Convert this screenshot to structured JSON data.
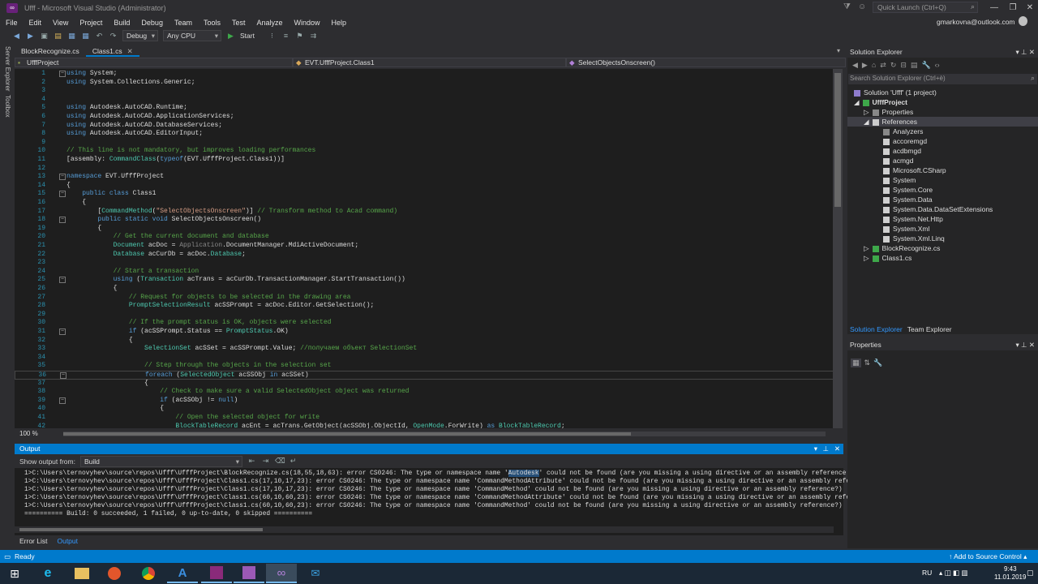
{
  "window": {
    "title": "Ufff - Microsoft Visual Studio (Administrator)",
    "quick_launch_placeholder": "Quick Launch (Ctrl+Q)",
    "user": "gmarkovna@outlook.com"
  },
  "menu": [
    "File",
    "Edit",
    "View",
    "Project",
    "Build",
    "Debug",
    "Team",
    "Tools",
    "Test",
    "Analyze",
    "Window",
    "Help"
  ],
  "toolbar": {
    "config": "Debug",
    "platform": "Any CPU",
    "start": "Start"
  },
  "side_tabs": [
    "Server Explorer",
    "Toolbox"
  ],
  "doc_tabs": [
    "BlockRecognize.cs",
    "Class1.cs"
  ],
  "nav": {
    "project": "UfffProject",
    "class": "EVT.UfffProject.Class1",
    "member": "SelectObjectsOnscreen()"
  },
  "code_lines": [
    {
      "n": "1",
      "t": "using System;",
      "k": "mix"
    },
    {
      "n": "2",
      "t": "using System.Collections.Generic;",
      "k": "mix"
    },
    {
      "n": "3",
      "t": "",
      "k": "tx"
    },
    {
      "n": "4",
      "t": "",
      "k": "tx"
    },
    {
      "n": "5",
      "t": "using Autodesk.AutoCAD.Runtime;",
      "k": "mix"
    },
    {
      "n": "6",
      "t": "using Autodesk.AutoCAD.ApplicationServices;",
      "k": "mix"
    },
    {
      "n": "7",
      "t": "using Autodesk.AutoCAD.DatabaseServices;",
      "k": "mix"
    },
    {
      "n": "8",
      "t": "using Autodesk.AutoCAD.EditorInput;",
      "k": "mix"
    },
    {
      "n": "9",
      "t": "",
      "k": "tx"
    },
    {
      "n": "10",
      "t": "// This line is not mandatory, but improves loading performances",
      "k": "cm"
    },
    {
      "n": "11",
      "t": "[assembly: CommandClass(typeof(EVT.UfffProject.Class1))]",
      "k": "tx"
    },
    {
      "n": "12",
      "t": "",
      "k": "tx"
    },
    {
      "n": "13",
      "t": "namespace EVT.UfffProject",
      "k": "mix"
    },
    {
      "n": "14",
      "t": "{",
      "k": "tx"
    },
    {
      "n": "15",
      "t": "    public class Class1",
      "k": "mix"
    },
    {
      "n": "16",
      "t": "    {",
      "k": "tx"
    },
    {
      "n": "17",
      "t": "        [CommandMethod(\"SelectObjectsOnscreen\")] // Transform method to Acad command)",
      "k": "tx"
    },
    {
      "n": "18",
      "t": "        public static void SelectObjectsOnscreen()",
      "k": "mix"
    },
    {
      "n": "19",
      "t": "        {",
      "k": "tx"
    },
    {
      "n": "20",
      "t": "            // Get the current document and database",
      "k": "cm"
    },
    {
      "n": "21",
      "t": "            Document acDoc = Application.DocumentManager.MdiActiveDocument;",
      "k": "tx"
    },
    {
      "n": "22",
      "t": "            Database acCurDb = acDoc.Database;",
      "k": "tx"
    },
    {
      "n": "23",
      "t": "",
      "k": "tx"
    },
    {
      "n": "24",
      "t": "            // Start a transaction",
      "k": "cm"
    },
    {
      "n": "25",
      "t": "            using (Transaction acTrans = acCurDb.TransactionManager.StartTransaction())",
      "k": "mix"
    },
    {
      "n": "26",
      "t": "            {",
      "k": "tx"
    },
    {
      "n": "27",
      "t": "                // Request for objects to be selected in the drawing area",
      "k": "cm"
    },
    {
      "n": "28",
      "t": "                PromptSelectionResult acSSPrompt = acDoc.Editor.GetSelection();",
      "k": "tx"
    },
    {
      "n": "29",
      "t": "",
      "k": "tx"
    },
    {
      "n": "30",
      "t": "                // If the prompt status is OK, objects were selected",
      "k": "cm"
    },
    {
      "n": "31",
      "t": "                if (acSSPrompt.Status == PromptStatus.OK)",
      "k": "mix"
    },
    {
      "n": "32",
      "t": "                {",
      "k": "tx"
    },
    {
      "n": "33",
      "t": "                    SelectionSet acSSet = acSSPrompt.Value; //получаем объект SelectionSet",
      "k": "tx"
    },
    {
      "n": "34",
      "t": "",
      "k": "tx"
    },
    {
      "n": "35",
      "t": "                    // Step through the objects in the selection set",
      "k": "cm"
    },
    {
      "n": "36",
      "t": "                    foreach (SelectedObject acSSObj in acSSet)",
      "k": "mix"
    },
    {
      "n": "37",
      "t": "                    {",
      "k": "tx"
    },
    {
      "n": "38",
      "t": "                        // Check to make sure a valid SelectedObject object was returned",
      "k": "cm"
    },
    {
      "n": "39",
      "t": "                        if (acSSObj != null)",
      "k": "mix"
    },
    {
      "n": "40",
      "t": "                        {",
      "k": "tx"
    },
    {
      "n": "41",
      "t": "                            // Open the selected object for write",
      "k": "cm"
    },
    {
      "n": "42",
      "t": "                            BlockTableRecord acEnt = acTrans.GetObject(acSSObj.ObjectId, OpenMode.ForWrite) as BlockTableRecord;",
      "k": "tx"
    }
  ],
  "zoom": "100 %",
  "output": {
    "title": "Output",
    "show_from_label": "Show output from:",
    "source": "Build",
    "lines": [
      "1>C:\\Users\\ternovyhev\\source\\repos\\Ufff\\UfffProject\\BlockRecognize.cs(18,55,18,63): error CS0246: The type or namespace name 'Autodesk' could not be found (are you missing a using directive or an assembly reference",
      "1>C:\\Users\\ternovyhev\\source\\repos\\Ufff\\UfffProject\\Class1.cs(17,10,17,23): error CS0246: The type or namespace name 'CommandMethodAttribute' could not be found (are you missing a using directive or an assembly refe",
      "1>C:\\Users\\ternovyhev\\source\\repos\\Ufff\\UfffProject\\Class1.cs(17,10,17,23): error CS0246: The type or namespace name 'CommandMethod' could not be found (are you missing a using directive or an assembly reference?)",
      "1>C:\\Users\\ternovyhev\\source\\repos\\Ufff\\UfffProject\\Class1.cs(60,10,60,23): error CS0246: The type or namespace name 'CommandMethodAttribute' could not be found (are you missing a using directive or an assembly refe",
      "1>C:\\Users\\ternovyhev\\source\\repos\\Ufff\\UfffProject\\Class1.cs(60,10,60,23): error CS0246: The type or namespace name 'CommandMethod' could not be found (are you missing a using directive or an assembly reference?)",
      "========== Build: 0 succeeded, 1 failed, 0 up-to-date, 0 skipped =========="
    ]
  },
  "bottom_tabs": [
    "Error List",
    "Output"
  ],
  "solution_explorer": {
    "title": "Solution Explorer",
    "search_placeholder": "Search Solution Explorer (Ctrl+è)",
    "solution": "Solution 'Ufff' (1 project)",
    "project": "UfffProject",
    "properties": "Properties",
    "references": "References",
    "refs": [
      "Analyzers",
      "accoremgd",
      "acdbmgd",
      "acmgd",
      "Microsoft.CSharp",
      "System",
      "System.Core",
      "System.Data",
      "System.Data.DataSetExtensions",
      "System.Net.Http",
      "System.Xml",
      "System.Xml.Linq"
    ],
    "files": [
      "BlockRecognize.cs",
      "Class1.cs"
    ],
    "tabs": [
      "Solution Explorer",
      "Team Explorer"
    ]
  },
  "properties_panel": {
    "title": "Properties"
  },
  "status": {
    "left": "Ready",
    "right": "Add to Source Control"
  },
  "taskbar": {
    "lang": "RU",
    "time": "9:43",
    "date": "11.01.2019"
  },
  "colors": {
    "accent": "#007acc",
    "editor_bg": "#1e1e1e",
    "chrome_bg": "#2d2d30",
    "keyword": "#569cd6",
    "type": "#4ec9b0",
    "comment": "#57a64a"
  }
}
